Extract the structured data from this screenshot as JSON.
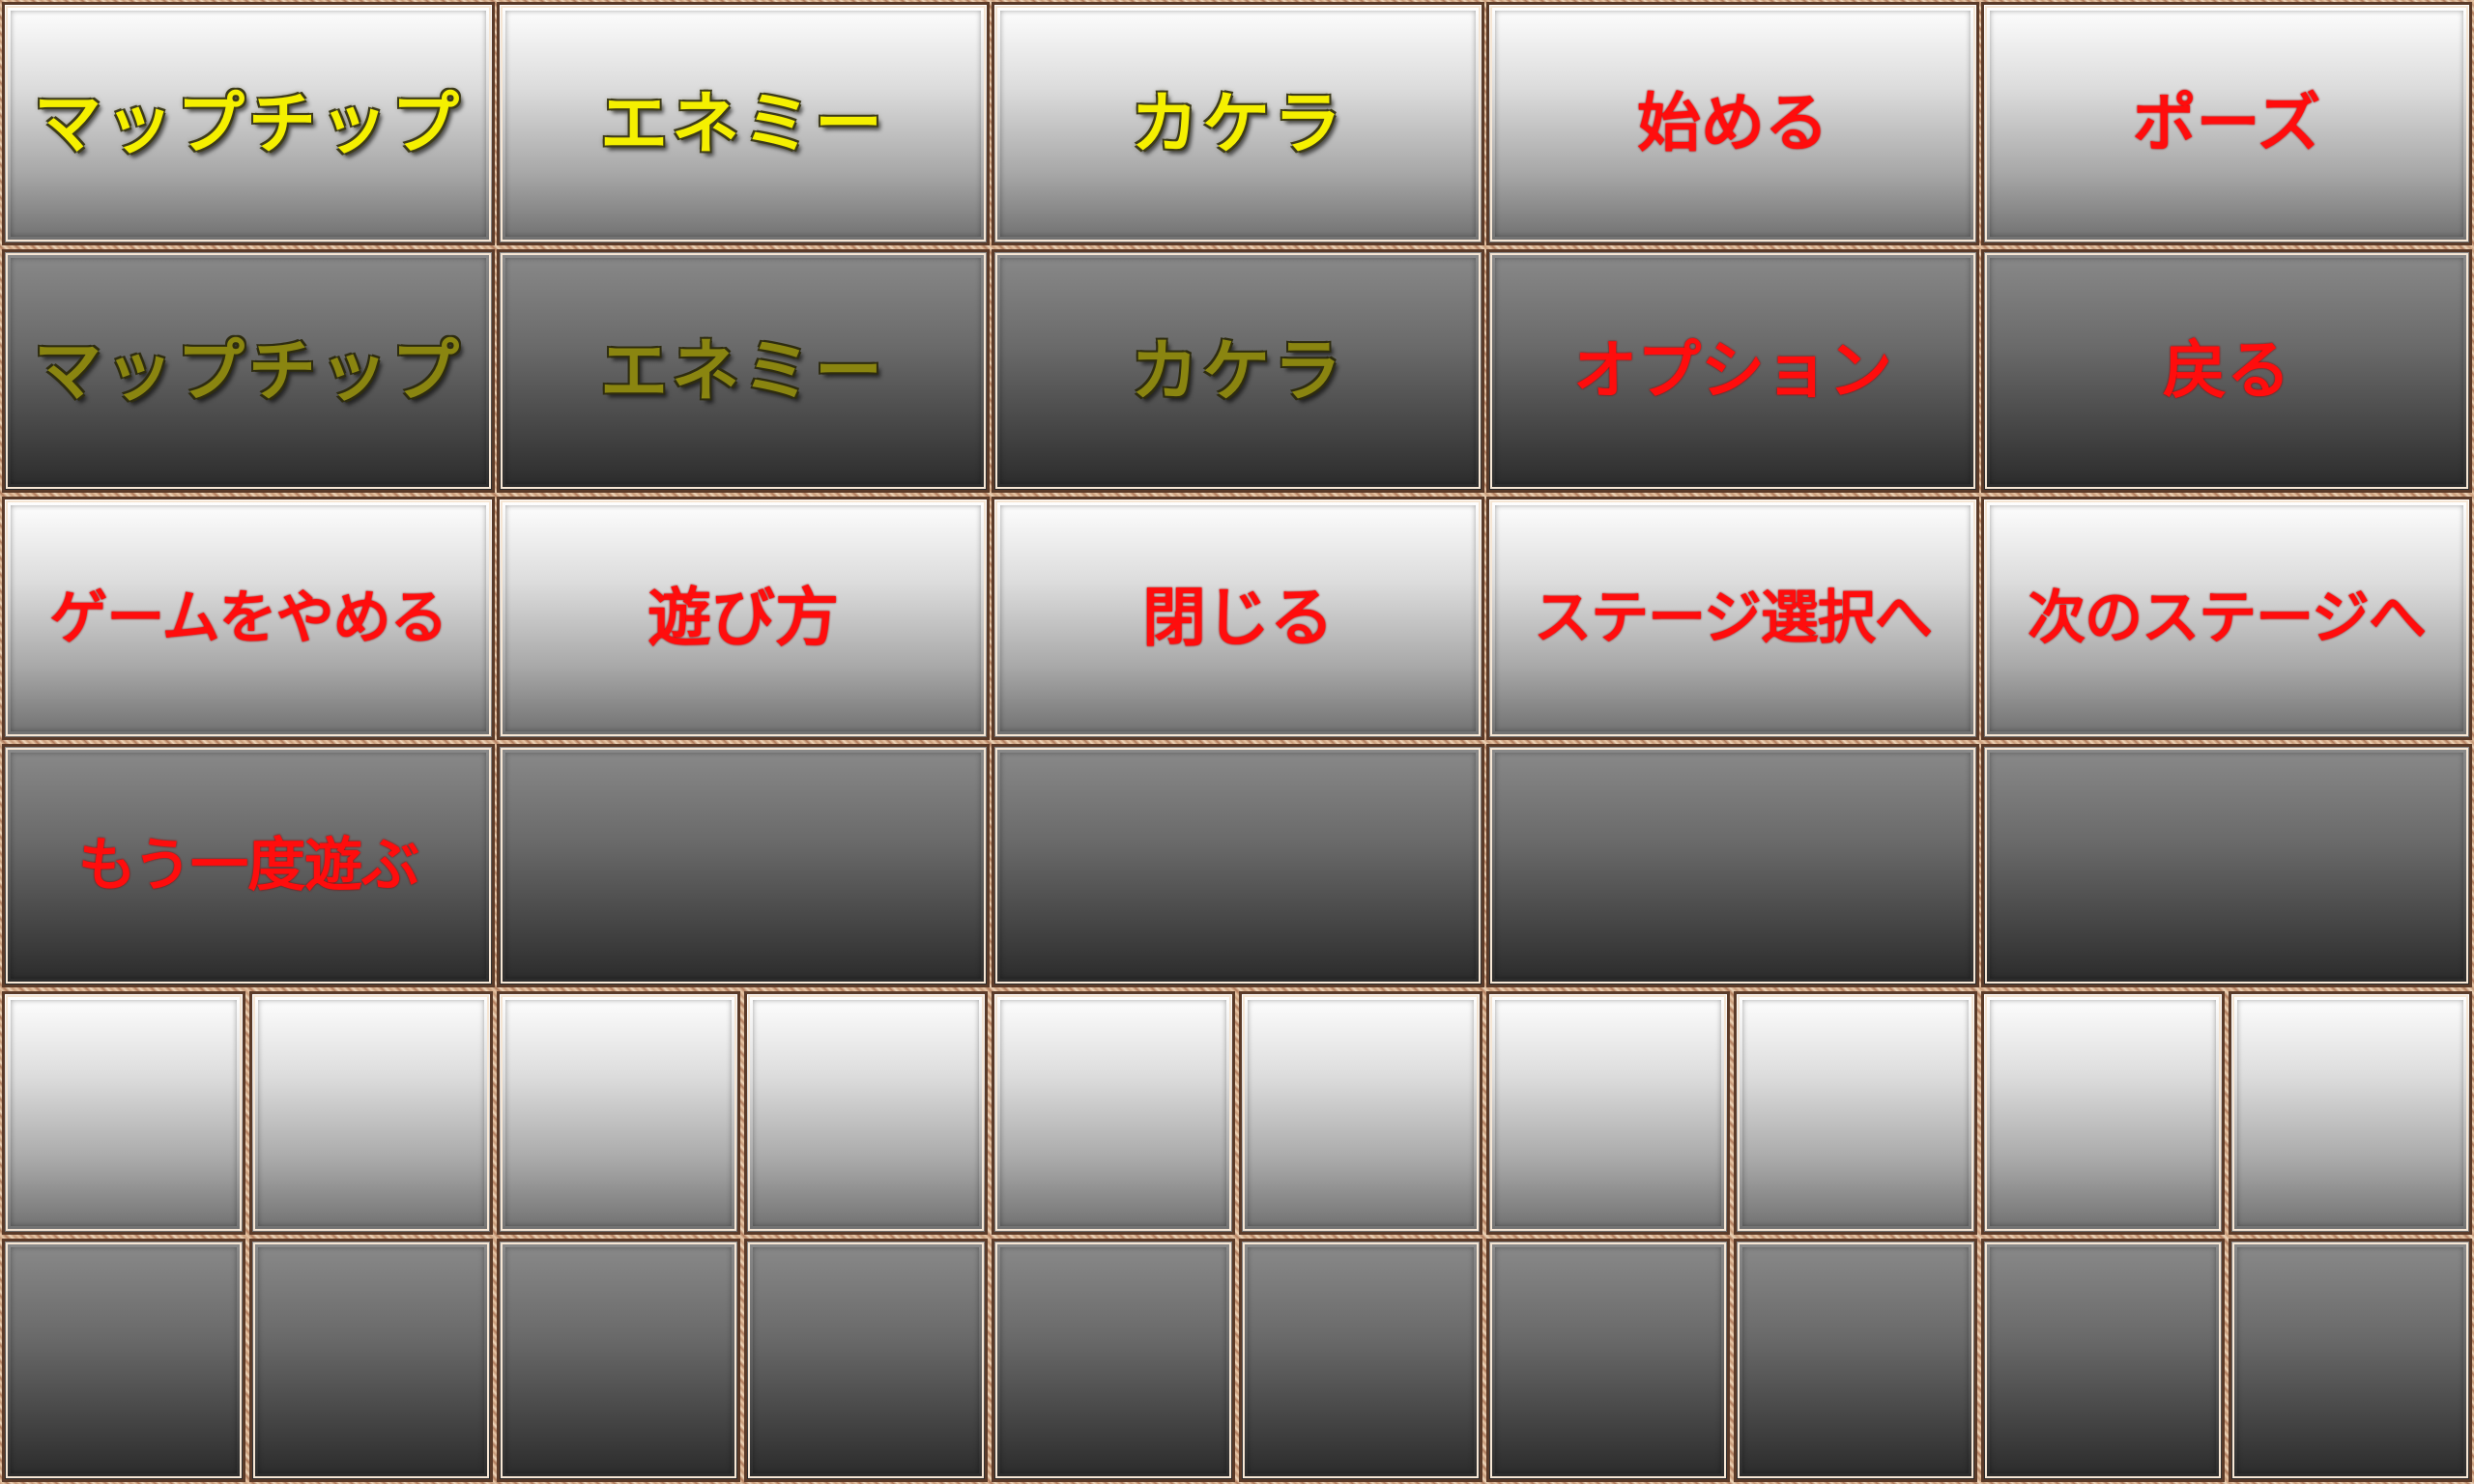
{
  "rows": {
    "row1": {
      "mapchip": "マップチップ",
      "enemy": "エネミー",
      "kakera": "カケラ",
      "start": "始める",
      "pause": "ポーズ"
    },
    "row2": {
      "mapchip": "マップチップ",
      "enemy": "エネミー",
      "kakera": "カケラ",
      "option": "オプション",
      "back": "戻る"
    },
    "row3": {
      "quit": "ゲームをやめる",
      "how_to_play": "遊び方",
      "close": "閉じる",
      "stage_select": "ステージ選択へ",
      "next_stage": "次のステージへ"
    },
    "row4": {
      "play_again": "もう一度遊ぶ"
    }
  },
  "colors": {
    "label_yellow": "#f5f000",
    "label_olive": "#8a8510",
    "label_red": "#ff0d0d",
    "frame": "#c89a78"
  }
}
